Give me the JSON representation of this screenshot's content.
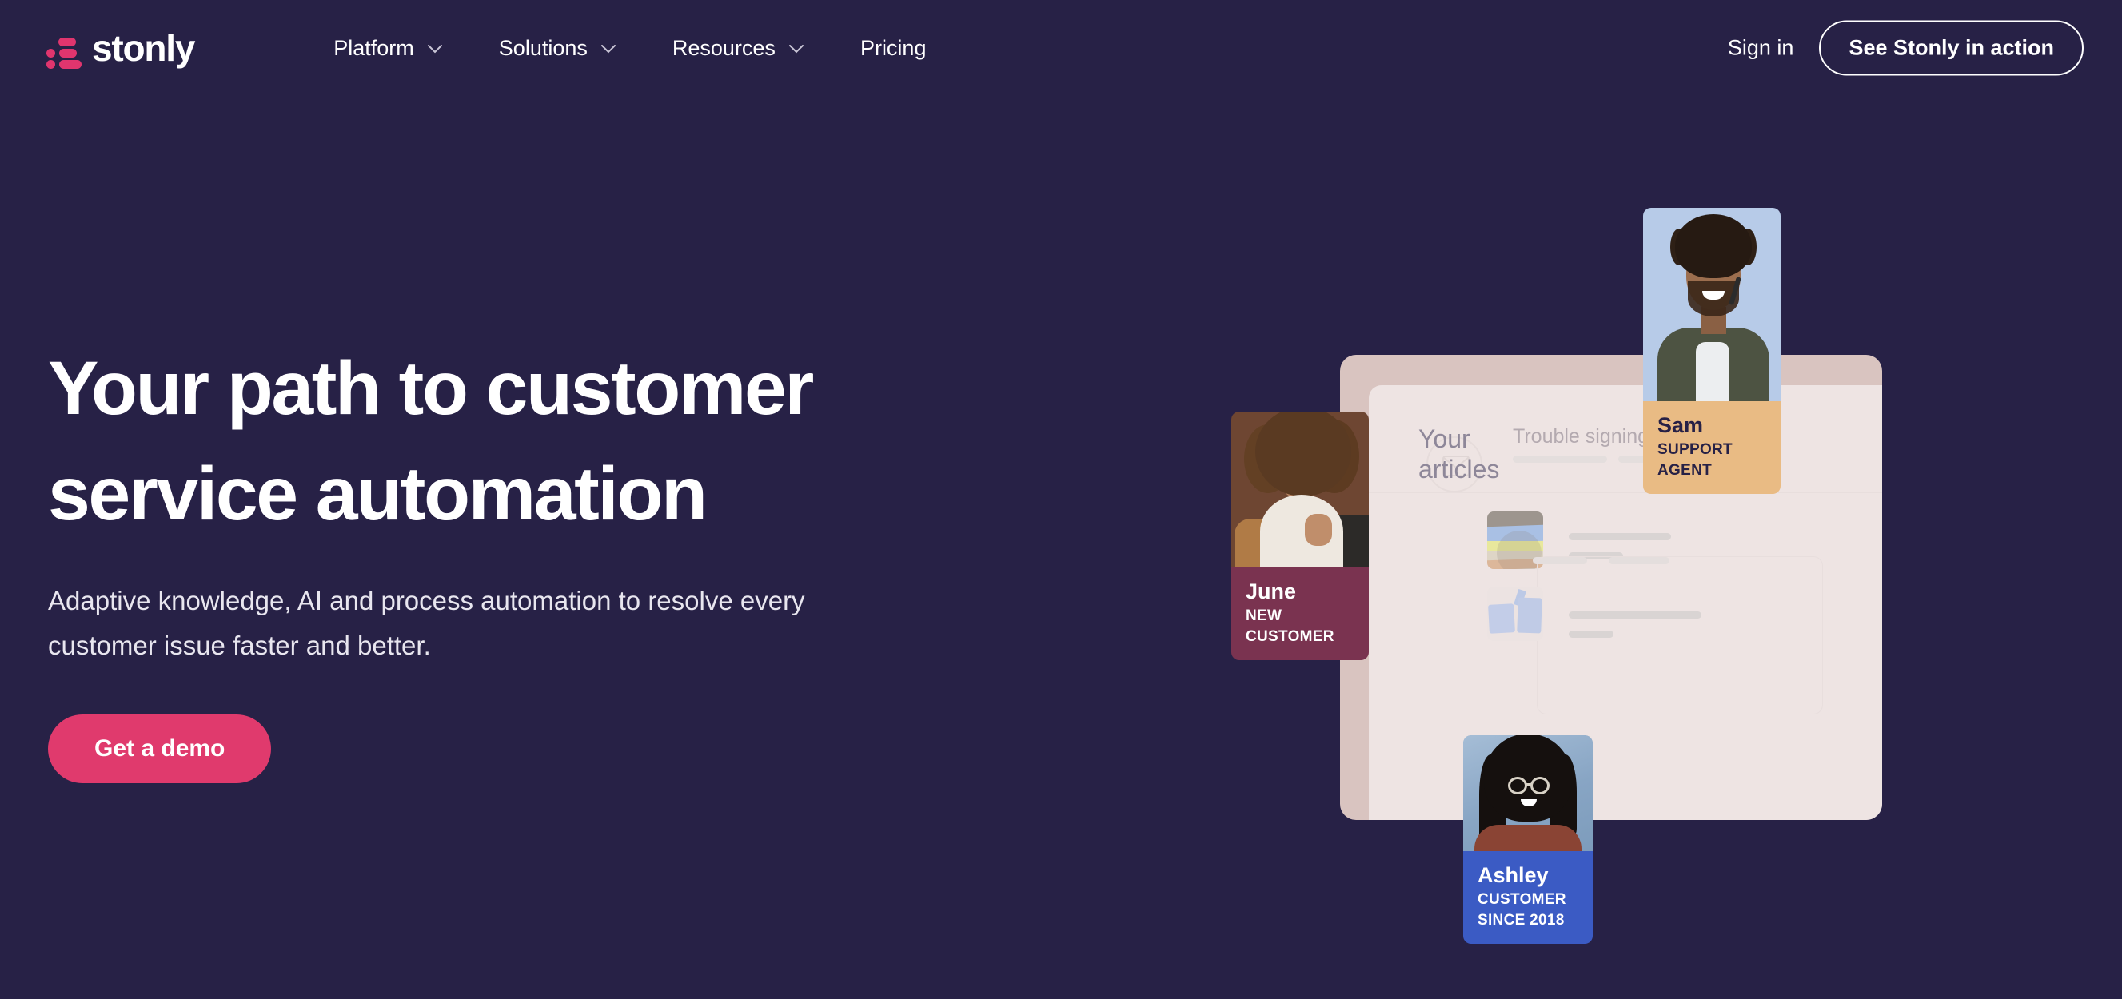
{
  "header": {
    "logo_text": "stonly",
    "flag_label": "ukraine-flag",
    "nav": [
      {
        "label": "Platform",
        "has_dropdown": true
      },
      {
        "label": "Solutions",
        "has_dropdown": true
      },
      {
        "label": "Resources",
        "has_dropdown": true
      },
      {
        "label": "Pricing",
        "has_dropdown": false
      }
    ],
    "sign_in": "Sign in",
    "cta": "See Stonly in action"
  },
  "hero": {
    "headline": "Your path to customer service automation",
    "subhead": "Adaptive knowledge, AI and process automation to resolve every customer issue faster and better.",
    "cta": "Get a demo"
  },
  "illustration": {
    "panel": {
      "heading": "Your articles",
      "search_text": "Trouble signing in"
    },
    "cards": [
      {
        "name": "Sam",
        "role": "SUPPORT AGENT"
      },
      {
        "name": "June",
        "role": "NEW CUSTOMER"
      },
      {
        "name": "Ashley",
        "role": "CUSTOMER SINCE 2018"
      }
    ]
  },
  "colors": {
    "background": "#272146",
    "accent_pink": "#e03a6d",
    "panel_frame": "#d9c4c0",
    "panel_inner": "#eee4e3",
    "sam_band": "#e9bb84",
    "june_band": "#7a3350",
    "ashley_band": "#3b5bc4"
  }
}
